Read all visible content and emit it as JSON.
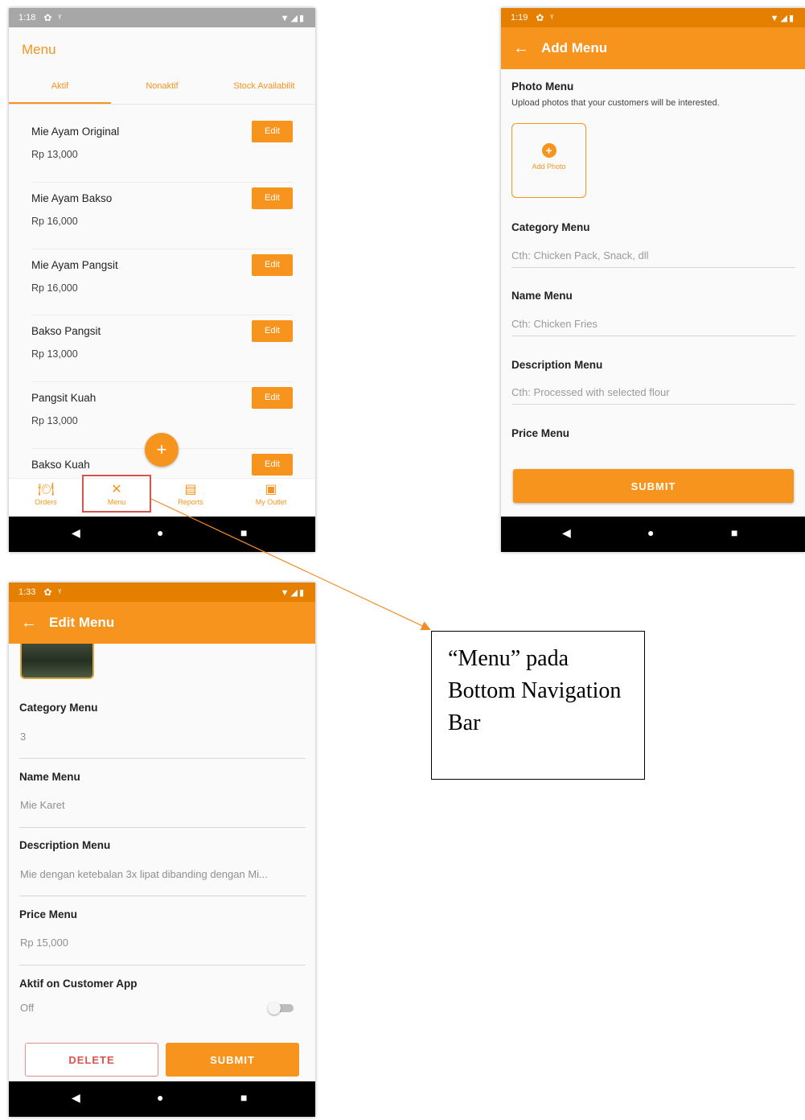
{
  "colors": {
    "brand": "#f7941d",
    "highlight": "#d9534f",
    "status_grey": "#a7a7a7",
    "status_orange": "#e57f00"
  },
  "screen_list": {
    "status_time": "1:18",
    "title": "Menu",
    "tabs": [
      "Aktif",
      "Nonaktif",
      "Stock Availabilit"
    ],
    "items": [
      {
        "name": "Mie Ayam Original",
        "price": "Rp 13,000",
        "edit": "Edit"
      },
      {
        "name": "Mie Ayam Bakso",
        "price": "Rp 16,000",
        "edit": "Edit"
      },
      {
        "name": "Mie Ayam Pangsit",
        "price": "Rp 16,000",
        "edit": "Edit"
      },
      {
        "name": "Bakso Pangsit",
        "price": "Rp 13,000",
        "edit": "Edit"
      },
      {
        "name": "Pangsit Kuah",
        "price": "Rp 13,000",
        "edit": "Edit"
      },
      {
        "name": "Bakso Kuah",
        "price": "",
        "edit": "Edit"
      }
    ],
    "fab_icon": "+",
    "nav": [
      {
        "label": "Orders",
        "icon": "orders-icon"
      },
      {
        "label": "Menu",
        "icon": "menu-cutlery-icon"
      },
      {
        "label": "Reports",
        "icon": "reports-icon"
      },
      {
        "label": "My Outlet",
        "icon": "store-icon"
      }
    ]
  },
  "screen_add": {
    "status_time": "1:19",
    "title": "Add Menu",
    "photo_label": "Photo Menu",
    "photo_desc": "Upload photos that your customers will be interested.",
    "add_photo": "Add Photo",
    "category_label": "Category Menu",
    "category_placeholder": "Cth: Chicken Pack, Snack, dll",
    "name_label": "Name Menu",
    "name_placeholder": "Cth: Chicken Fries",
    "desc_label": "Description Menu",
    "desc_placeholder": "Cth: Processed with selected flour",
    "price_label": "Price Menu",
    "submit": "SUBMIT"
  },
  "screen_edit": {
    "status_time": "1:33",
    "title": "Edit Menu",
    "category_label": "Category Menu",
    "category_value": "3",
    "name_label": "Name Menu",
    "name_value": "Mie Karet",
    "desc_label": "Description Menu",
    "desc_value": "Mie dengan ketebalan 3x lipat dibanding dengan Mi...",
    "price_label": "Price Menu",
    "price_value": "Rp 15,000",
    "active_label": "Aktif on Customer App",
    "active_value": "Off",
    "delete": "DELETE",
    "submit": "SUBMIT"
  },
  "system_nav": {
    "back": "◀",
    "home": "●",
    "recents": "■"
  },
  "annotation": {
    "text": "“Menu” pada Bottom Navigation Bar"
  }
}
